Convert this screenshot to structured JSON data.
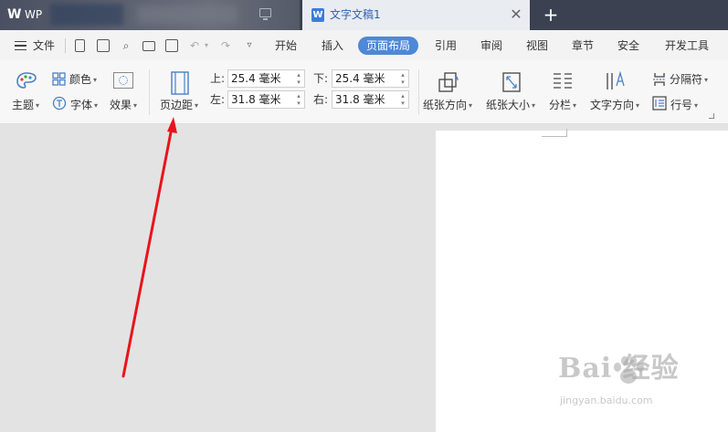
{
  "titlebar": {
    "app_name": "WP",
    "document_tab_title": "文字文稿1",
    "doc_icon_letter": "W",
    "close_glyph": "✕",
    "new_tab_glyph": "+"
  },
  "menubar": {
    "file_label": "文件",
    "tabs": [
      "开始",
      "插入",
      "页面布局",
      "引用",
      "审阅",
      "视图",
      "章节",
      "安全",
      "开发工具"
    ],
    "active_tab": "页面布局"
  },
  "ribbon": {
    "theme_label": "主题",
    "color_label": "颜色",
    "font_label": "字体",
    "effect_label": "效果",
    "margins_label": "页边距",
    "top_label": "上:",
    "top_value": "25.4 毫米",
    "bottom_label": "下:",
    "bottom_value": "25.4 毫米",
    "left_label": "左:",
    "left_value": "31.8 毫米",
    "right_label": "右:",
    "right_value": "31.8 毫米",
    "orientation_label": "纸张方向",
    "size_label": "纸张大小",
    "columns_label": "分栏",
    "text_direction_label": "文字方向",
    "breaks_label": "分隔符",
    "line_numbers_label": "行号"
  },
  "watermark": {
    "brand": "Bai  经验",
    "url": "jingyan.baidu.com"
  },
  "colors": {
    "titlebar_bg": "#3b4150",
    "active_tab_bg": "#4e88d6",
    "arrow": "#e8141c",
    "canvas_bg": "#e3e3e3"
  }
}
